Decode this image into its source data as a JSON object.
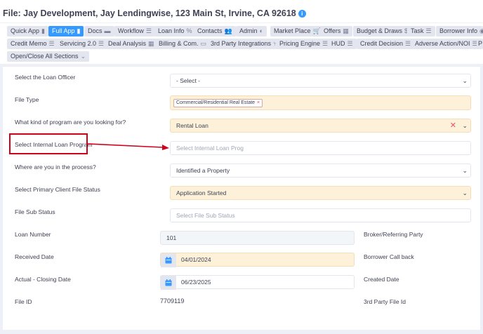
{
  "header": {
    "title": "File: Jay Development, Jay Lendingwise, 123 Main St, Irvine, CA 92618"
  },
  "tabs": [
    {
      "label": "Quick App",
      "icon": "document-icon",
      "glyph": "▮"
    },
    {
      "label": "Full App",
      "icon": "document-icon",
      "glyph": "▮",
      "active": true
    },
    {
      "label": "Docs",
      "icon": "folder-icon",
      "glyph": "▬"
    },
    {
      "label": "Workflow",
      "icon": "list-icon",
      "glyph": "☰"
    },
    {
      "label": "Loan Info",
      "icon": "percent-icon",
      "glyph": "%"
    },
    {
      "label": "Contacts",
      "icon": "users-icon",
      "glyph": "👥"
    },
    {
      "label": "Admin",
      "icon": "shield-icon",
      "glyph": "◐"
    },
    {
      "label": "Market Place",
      "icon": "cart-icon",
      "glyph": "🛒"
    },
    {
      "label": "Offers",
      "icon": "gift-icon",
      "glyph": "▦"
    },
    {
      "label": "Budget & Draws",
      "icon": "dollar-icon",
      "glyph": "$"
    },
    {
      "label": "Task",
      "icon": "list-icon",
      "glyph": "☰"
    },
    {
      "label": "Borrower Info",
      "icon": "user-icon",
      "glyph": "◉"
    },
    {
      "label": "Credit Memo",
      "icon": "list-icon",
      "glyph": "☰"
    },
    {
      "label": "Servicing 2.0",
      "icon": "list-icon",
      "glyph": "☰"
    },
    {
      "label": "Deal Analysis",
      "icon": "gift-icon",
      "glyph": "▦"
    },
    {
      "label": "Billing & Com.",
      "icon": "card-icon",
      "glyph": "▭"
    },
    {
      "label": "3rd Party Integrations",
      "icon": "branch-icon",
      "glyph": "⑂"
    },
    {
      "label": "Pricing Engine",
      "icon": "list-icon",
      "glyph": "☰"
    },
    {
      "label": "HUD",
      "icon": "list-icon",
      "glyph": "☰"
    },
    {
      "label": "Credit Decision",
      "icon": "list-icon",
      "glyph": "☰"
    },
    {
      "label": "Adverse Action/NOI",
      "icon": "list-icon",
      "glyph": "☰"
    },
    {
      "label": "P",
      "icon": "",
      "glyph": ""
    },
    {
      "label": "Open/Close All Sections",
      "icon": "chevron-down-icon",
      "glyph": "⌄"
    }
  ],
  "form": {
    "loan_officer": {
      "label": "Select the Loan Officer",
      "value": "- Select -"
    },
    "file_type": {
      "label": "File Type",
      "chip": "Commercial/Residential Real Estate",
      "chip_x": "×"
    },
    "program_kind": {
      "label": "What kind of program are you looking for?",
      "value": "Rental Loan",
      "clear": "✕"
    },
    "internal_program": {
      "label": "Select Internal Loan Program",
      "placeholder": "Select Internal Loan Prog"
    },
    "process": {
      "label": "Where are you in the process?",
      "value": "Identified a Property"
    },
    "client_status": {
      "label": "Select Primary Client File Status",
      "value": "Application Started"
    },
    "sub_status": {
      "label": "File Sub Status",
      "placeholder": "Select File Sub Status"
    },
    "loan_number": {
      "label": "Loan Number",
      "value": "101"
    },
    "received_date": {
      "label": "Received Date",
      "value": "04/01/2024"
    },
    "closing_date": {
      "label": "Actual - Closing Date",
      "value": "06/23/2025"
    },
    "file_id": {
      "label": "File ID",
      "value": "7709119"
    },
    "broker": {
      "label": "Broker/Referring Party"
    },
    "call_back": {
      "label": "Borrower Call back"
    },
    "created_date": {
      "label": "Created Date"
    },
    "third_party_id": {
      "label": "3rd Party File Id"
    }
  },
  "colors": {
    "accent": "#3699ff",
    "highlight_field": "#fdf1d9",
    "annotation": "#d0021b"
  }
}
